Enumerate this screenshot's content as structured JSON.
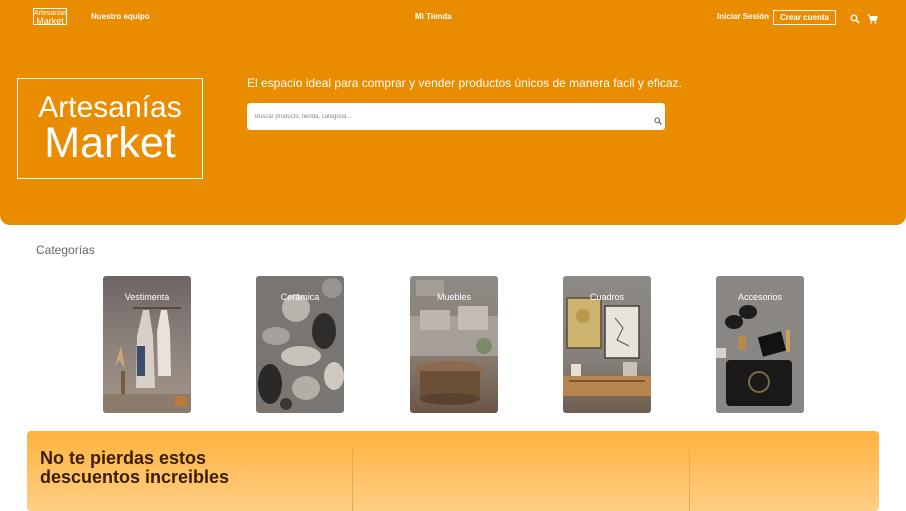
{
  "nav": {
    "logo_line1": "Artesanías",
    "logo_line2": "Market",
    "team": "Nuestro equipo",
    "my_store": "Mi Tienda",
    "login": "Iniciar Sesión",
    "signup": "Crear cuenta",
    "icons": [
      "search-icon",
      "cart-icon"
    ]
  },
  "hero": {
    "logo_line1": "Artesanías",
    "logo_line2": "Market",
    "tagline": "El espacio ideal para comprar y vender productos únicos de manera facil y eficaz.",
    "search_placeholder": "Buscar producto, tienda, categoria..."
  },
  "categories": {
    "title": "Categorías",
    "items": [
      {
        "label": "Vestimenta"
      },
      {
        "label": "Cerámica"
      },
      {
        "label": "Muebles"
      },
      {
        "label": "Cuadros"
      },
      {
        "label": "Accesorios"
      }
    ]
  },
  "promo": {
    "title": "No te pierdas estos descuentos increibles"
  },
  "colors": {
    "brand_orange": "#ea8c00",
    "promo_top": "#ffb23e",
    "promo_bottom": "#ffcf85"
  }
}
